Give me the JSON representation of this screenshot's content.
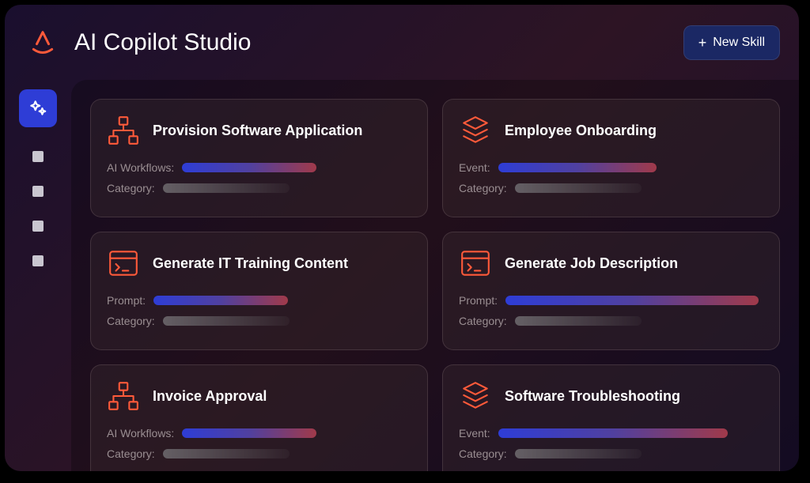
{
  "header": {
    "title": "AI Copilot Studio",
    "new_skill_label": "New Skill"
  },
  "cards": [
    {
      "icon": "hierarchy",
      "title": "Provision Software Application",
      "row1_label": "AI Workflows:",
      "row2_label": "Category:",
      "bar_w": "w1"
    },
    {
      "icon": "layers",
      "title": "Employee Onboarding",
      "row1_label": "Event:",
      "row2_label": "Category:",
      "bar_w": "w2"
    },
    {
      "icon": "terminal",
      "title": "Generate IT Training Content",
      "row1_label": "Prompt:",
      "row2_label": "Category:",
      "bar_w": "w1"
    },
    {
      "icon": "terminal",
      "title": "Generate Job Description",
      "row1_label": "Prompt:",
      "row2_label": "Category:",
      "bar_w": "w4"
    },
    {
      "icon": "hierarchy",
      "title": "Invoice Approval",
      "row1_label": "AI Workflows:",
      "row2_label": "Category:",
      "bar_w": "w1"
    },
    {
      "icon": "layers",
      "title": "Software Troubleshooting",
      "row1_label": "Event:",
      "row2_label": "Category:",
      "bar_w": "w3"
    }
  ]
}
